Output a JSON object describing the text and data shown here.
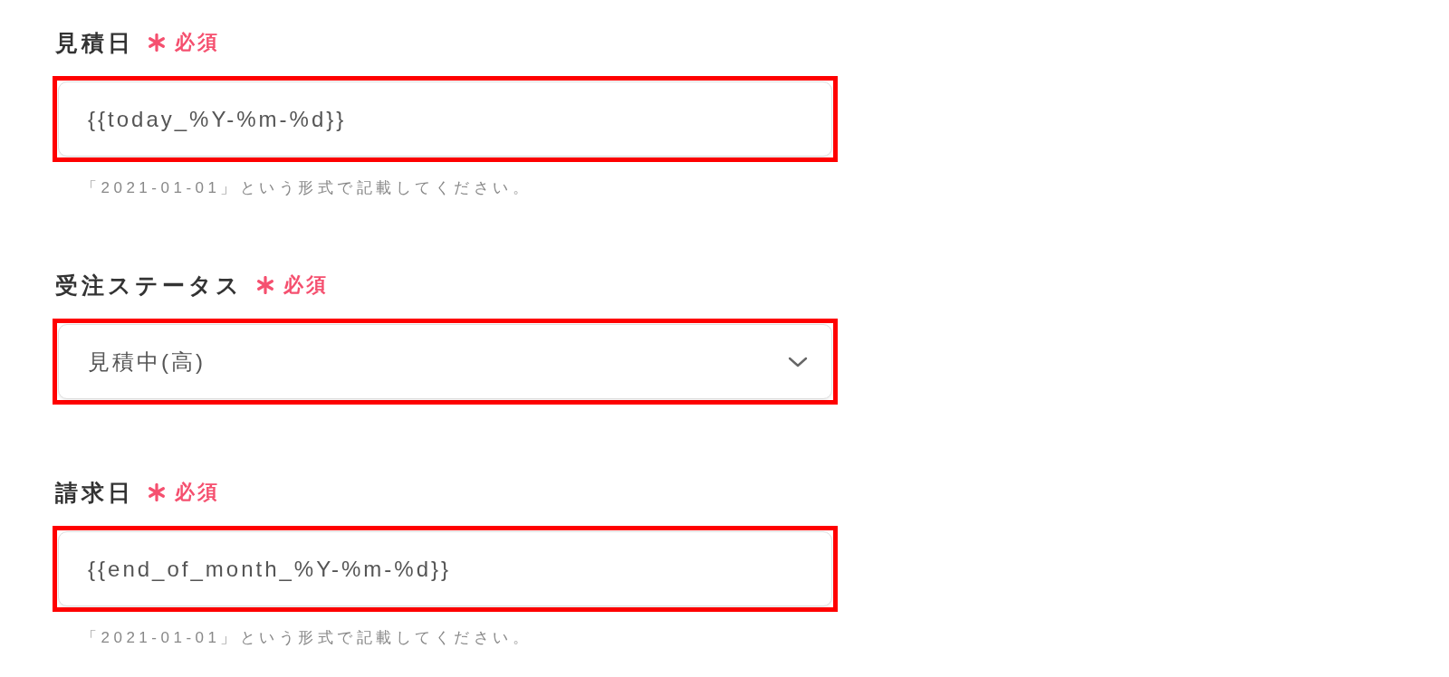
{
  "fields": [
    {
      "kind": "text",
      "label": "見積日",
      "required": true,
      "required_label": "必須",
      "highlighted": true,
      "value": "{{today_%Y-%m-%d}}",
      "hint": "「2021-01-01」という形式で記載してください。"
    },
    {
      "kind": "select",
      "label": "受注ステータス",
      "required": true,
      "required_label": "必須",
      "highlighted": true,
      "value": "見積中(高)"
    },
    {
      "kind": "text",
      "label": "請求日",
      "required": true,
      "required_label": "必須",
      "highlighted": true,
      "value": "{{end_of_month_%Y-%m-%d}}",
      "hint": "「2021-01-01」という形式で記載してください。"
    }
  ]
}
